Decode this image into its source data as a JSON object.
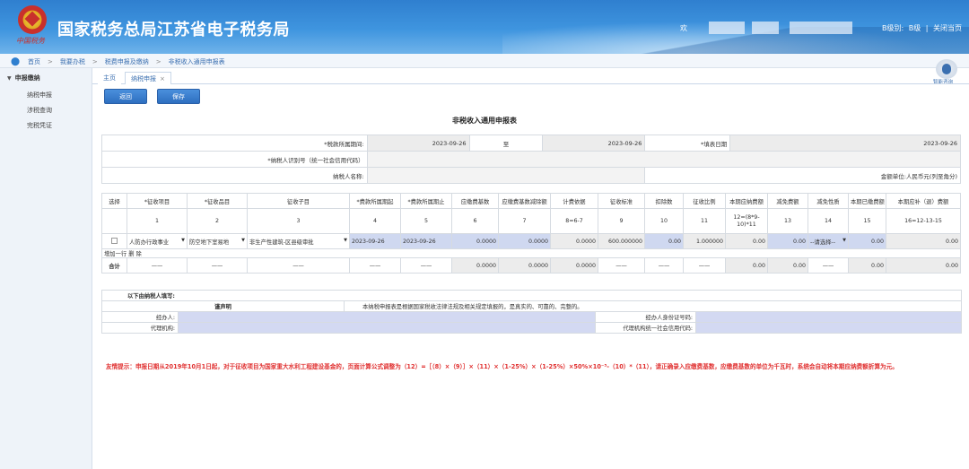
{
  "header": {
    "title": "国家税务总局江苏省电子税务局",
    "emblem_script": "中国税务",
    "welcome": "欢",
    "user_level": "B级别:",
    "user_level_suffix": "B级",
    "separator": "|",
    "close_link": "关闭当页"
  },
  "breadcrumb": [
    "首页",
    "我要办税",
    "税费申报及缴纳",
    "非税收入通用申报表"
  ],
  "sidebar": {
    "heading": "申报缴纳",
    "items": [
      "纳税申报",
      "涉税查询",
      "完税凭证"
    ]
  },
  "assistant_label": "智能咨询",
  "tabs": [
    {
      "label": "主页"
    },
    {
      "label": "纳税申报",
      "close": "×"
    }
  ],
  "buttons": {
    "back": "返回",
    "save": "保存"
  },
  "report_title": "非税收入通用申报表",
  "info": {
    "period_label": "*税款所属期间:",
    "period_start": "2023-09-26",
    "period_to": "至",
    "period_end": "2023-09-26",
    "fill_date_label": "*填表日期",
    "fill_date": "2023-09-26",
    "taxpayer_id_label": "*纳税人识别号（统一社会信用代码）",
    "taxpayer_name_label": "纳税人名称:",
    "amount_unit": "金额单位:人民币元(列至角分)"
  },
  "table": {
    "headers": [
      "选择",
      "*征收项目",
      "*征收品目",
      "征收子目",
      "*费款所属期起",
      "*费款所属期止",
      "应缴费基数",
      "应缴费基数减除额",
      "计费依据",
      "征收标准",
      "扣除数",
      "征收比例",
      "本期应纳费额",
      "减免费额",
      "减免性质",
      "本期已缴费额",
      "本期应补（退）费额"
    ],
    "numbers": [
      "1",
      "2",
      "3",
      "4",
      "5",
      "6",
      "7",
      "8=6-7",
      "9",
      "10",
      "11",
      "12=(8*9-10)*11",
      "13",
      "14",
      "15",
      "16=12-13-15"
    ],
    "row": {
      "item": "人防办行政事业",
      "category": "防空地下室易地",
      "sub": "非生产性建筑-区县级审批",
      "start": "2023-09-26",
      "end": "2023-09-26",
      "base": "0.0000",
      "deduct_base": "0.0000",
      "basis": "0.0000",
      "standard": "600.000000",
      "deduction": "0.00",
      "ratio": "1.000000",
      "payable": "0.00",
      "reduction": "0.00",
      "reduction_nature": "--请选择--",
      "paid": "0.00",
      "balance": "0.00"
    },
    "row_actions": "增加一行 删 除",
    "total_label": "合计",
    "total": {
      "dash": "——",
      "base": "0.0000",
      "deduct_base": "0.0000",
      "basis": "0.0000",
      "payable": "0.00",
      "reduction": "0.00",
      "paid": "0.00",
      "balance": "0.00"
    }
  },
  "declaration": {
    "heading": "以下由纳税人填写:",
    "statement_label": "谨声明",
    "statement": "本纳税申报表是根据国家税收法律法规及相关规定填报的，是真实的、可靠的、完整的。",
    "handler_label": "经办人:",
    "handler_id_label": "经办人身份证号码:",
    "agency_label": "代理机构:",
    "agency_code_label": "代理机构统一社会信用代码:"
  },
  "note": "友情提示：申报日期从2019年10月1日起，对于征收项目为国家重大水利工程建设基金的，页面计算公式调整为（12）=［（8）×（9）］×（11）×（1-25%）×（1-25%）×50%×10⁻³-（10）*（11），请正确录入应缴费基数，应缴费基数的单位为千瓦时，系统会自动将本期应纳费额折算为元。"
}
